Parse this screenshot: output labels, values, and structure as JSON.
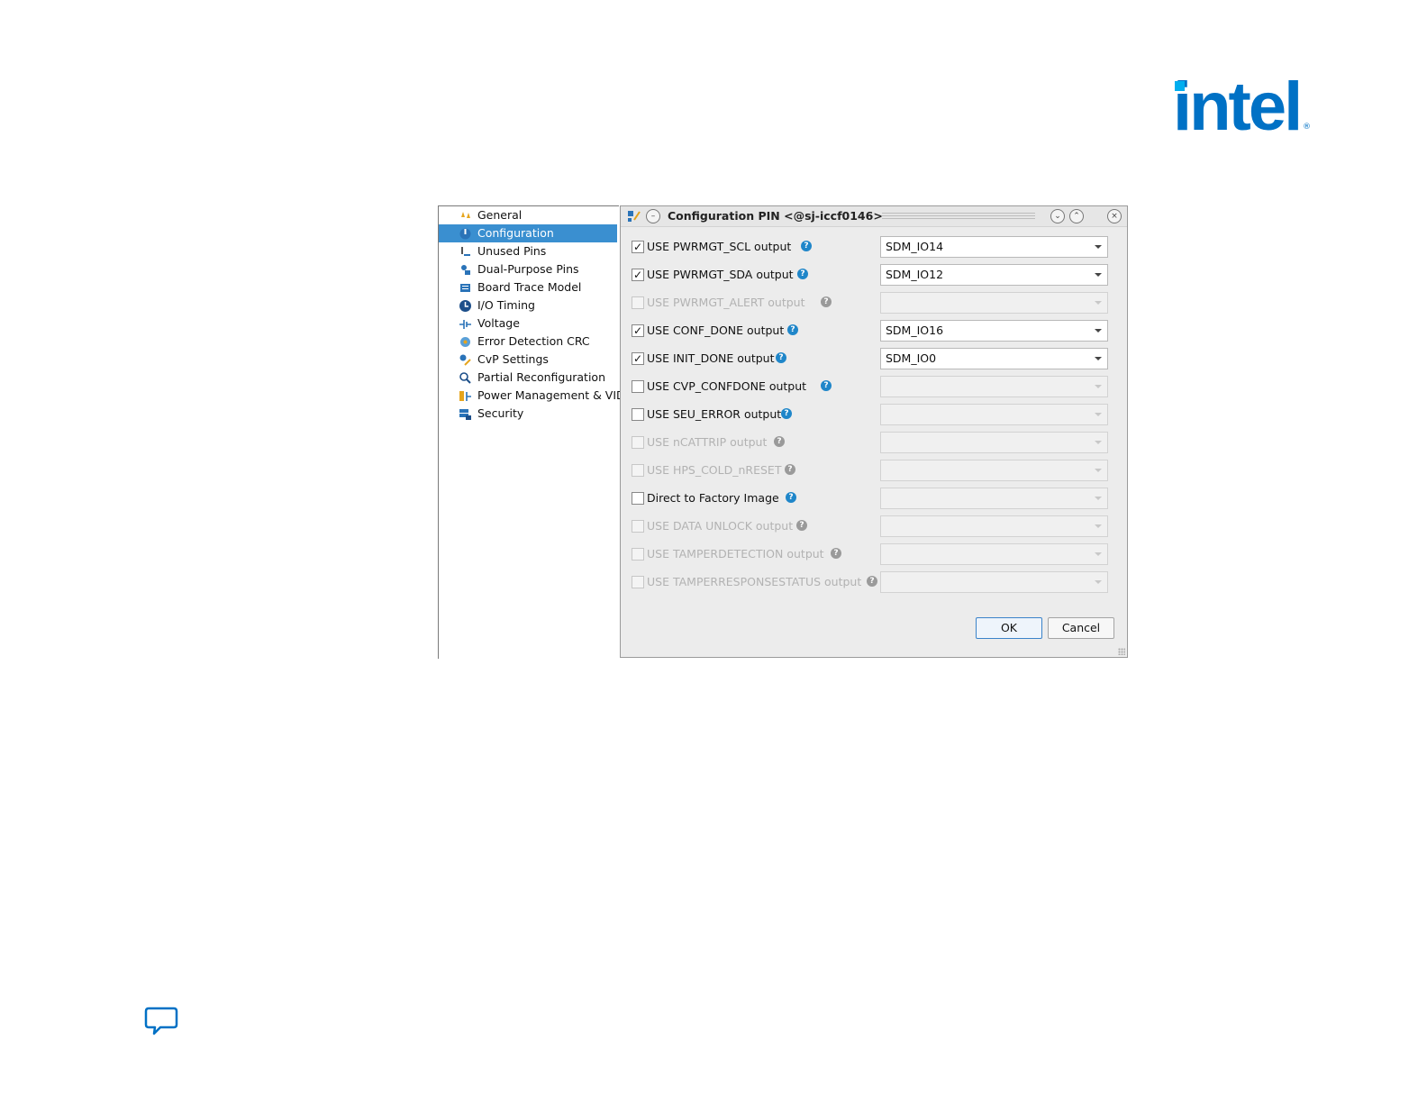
{
  "logo": {
    "text": "intel",
    "reg": "®"
  },
  "tree": {
    "items": [
      {
        "label": "General",
        "icon": "stars-icon",
        "selected": false
      },
      {
        "label": "Configuration",
        "icon": "config-icon",
        "selected": true
      },
      {
        "label": "Unused Pins",
        "icon": "unused-pins-icon",
        "selected": false
      },
      {
        "label": "Dual-Purpose Pins",
        "icon": "dual-purpose-pins-icon",
        "selected": false
      },
      {
        "label": "Board Trace Model",
        "icon": "board-trace-icon",
        "selected": false
      },
      {
        "label": "I/O Timing",
        "icon": "clock-icon",
        "selected": false
      },
      {
        "label": "Voltage",
        "icon": "voltage-icon",
        "selected": false
      },
      {
        "label": "Error Detection CRC",
        "icon": "error-detection-icon",
        "selected": false
      },
      {
        "label": "CvP Settings",
        "icon": "cvp-icon",
        "selected": false
      },
      {
        "label": "Partial Reconfiguration",
        "icon": "partial-reconfig-icon",
        "selected": false
      },
      {
        "label": "Power Management & VID",
        "icon": "power-icon",
        "selected": false
      },
      {
        "label": "Security",
        "icon": "security-icon",
        "selected": false
      }
    ]
  },
  "dialog": {
    "title": "Configuration PIN <@sj-iccf0146>",
    "rows": [
      {
        "label": "USE PWRMGT_SCL output",
        "checked": true,
        "enabled": true,
        "value": "SDM_IO14"
      },
      {
        "label": "USE PWRMGT_SDA output",
        "checked": true,
        "enabled": true,
        "value": "SDM_IO12"
      },
      {
        "label": "USE PWRMGT_ALERT output",
        "checked": false,
        "enabled": false,
        "value": ""
      },
      {
        "label": "USE CONF_DONE output",
        "checked": true,
        "enabled": true,
        "value": "SDM_IO16"
      },
      {
        "label": "USE INIT_DONE output",
        "checked": true,
        "enabled": true,
        "value": "SDM_IO0"
      },
      {
        "label": "USE CVP_CONFDONE output",
        "checked": false,
        "enabled": true,
        "value": ""
      },
      {
        "label": "USE SEU_ERROR output",
        "checked": false,
        "enabled": true,
        "value": ""
      },
      {
        "label": "USE nCATTRIP output",
        "checked": false,
        "enabled": false,
        "value": ""
      },
      {
        "label": "USE HPS_COLD_nRESET",
        "checked": false,
        "enabled": false,
        "value": ""
      },
      {
        "label": "Direct to Factory Image",
        "checked": false,
        "enabled": true,
        "value": ""
      },
      {
        "label": "USE DATA UNLOCK output",
        "checked": false,
        "enabled": false,
        "value": ""
      },
      {
        "label": "USE TAMPERDETECTION output",
        "checked": false,
        "enabled": false,
        "value": ""
      },
      {
        "label": "USE TAMPERRESPONSESTATUS output",
        "checked": false,
        "enabled": false,
        "value": ""
      }
    ],
    "ok_label": "OK",
    "cancel_label": "Cancel",
    "help_glyph": "?",
    "check_glyph": "✓"
  },
  "colors": {
    "accent": "#0071c5",
    "selection": "#3a8fd0",
    "help": "#1f86c9"
  }
}
